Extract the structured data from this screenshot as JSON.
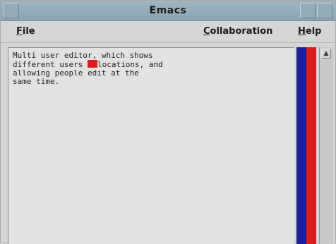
{
  "window": {
    "title": "Emacs"
  },
  "menubar": {
    "file": {
      "mnemonic": "F",
      "rest": "ile"
    },
    "collaboration": {
      "mnemonic": "C",
      "rest": "ollaboration"
    },
    "help": {
      "mnemonic": "H",
      "rest": "elp"
    }
  },
  "editor": {
    "text_before_cursor": "Multi user editor, which shows\ndifferent users ",
    "text_after_cursor": "locations, and\nallowing people edit at the\nsame time."
  },
  "users": [
    {
      "color": "#1b1f99"
    },
    {
      "color": "#e11a1a"
    }
  ],
  "scrollbar": {
    "up_arrow_icon": "triangle-up"
  }
}
